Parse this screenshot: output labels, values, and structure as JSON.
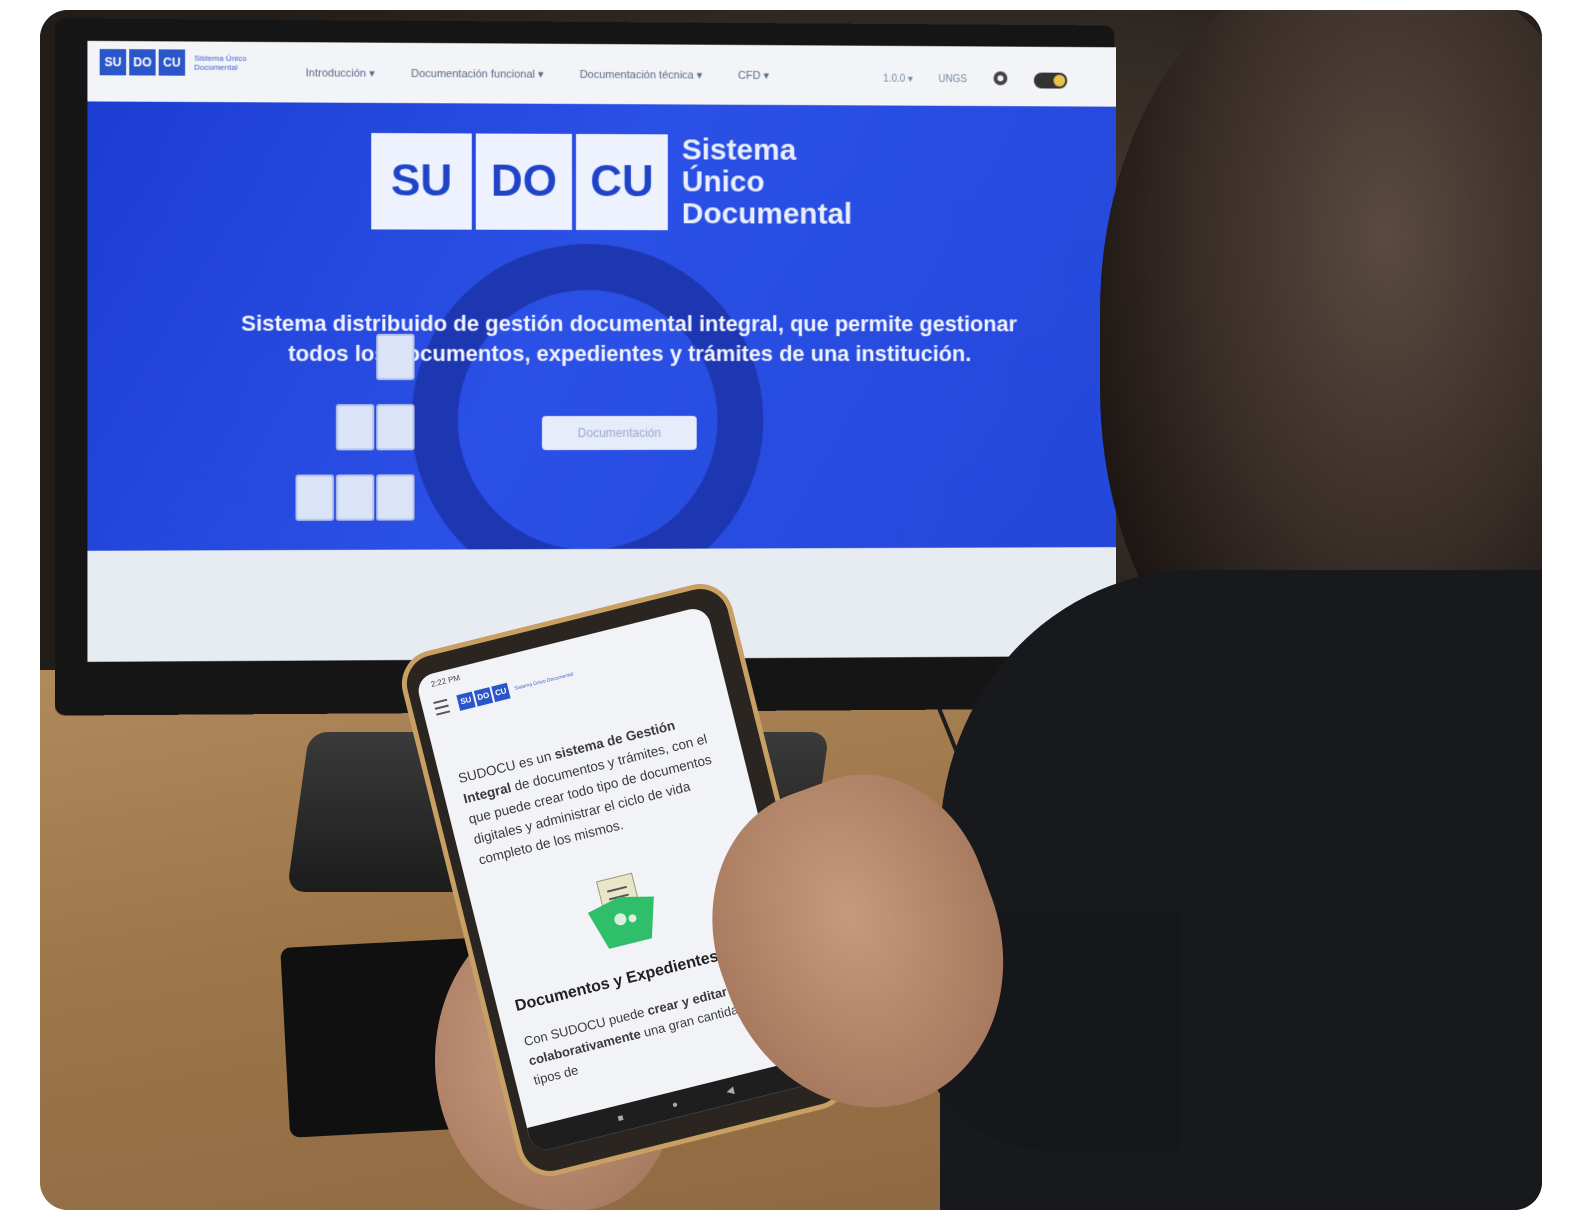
{
  "monitor": {
    "nav": {
      "logo_letters": [
        "SU",
        "DO",
        "CU"
      ],
      "logo_text": "Sistema Único Documental",
      "menu": [
        "Introducción ▾",
        "Documentación funcional ▾",
        "Documentación técnica ▾",
        "CFD ▾"
      ],
      "right": [
        "1.0.0 ▾",
        "UNGS"
      ],
      "github_icon": "github-icon"
    },
    "hero": {
      "tiles": [
        "SU",
        "DO",
        "CU"
      ],
      "title_lines": [
        "Sistema",
        "Único",
        "Documental"
      ],
      "tagline": "Sistema distribuido de gestión documental integral, que permite gestionar todos los documentos, expedientes y trámites de una institución.",
      "button_label": "Documentación"
    }
  },
  "phone": {
    "status_time": "2:22 PM",
    "logo_letters": [
      "SU",
      "DO",
      "CU"
    ],
    "logo_text": "Sistema Único Documental",
    "intro_prefix": "SUDOCU es un ",
    "intro_bold": "sistema de Gestión Integral",
    "intro_rest": " de documentos y trámites, con el que puede crear todo tipo de documentos digitales y administrar el ciclo de vida completo de los mismos.",
    "section_heading": "Documentos y Expedientes",
    "section_text_prefix": "Con SUDOCU puede ",
    "section_text_bold": "crear y editar colaborativamente",
    "section_text_rest": " una gran cantidad de tipos de"
  },
  "colors": {
    "brand_blue": "#2b56c9",
    "hero_blue": "#2347d8"
  }
}
